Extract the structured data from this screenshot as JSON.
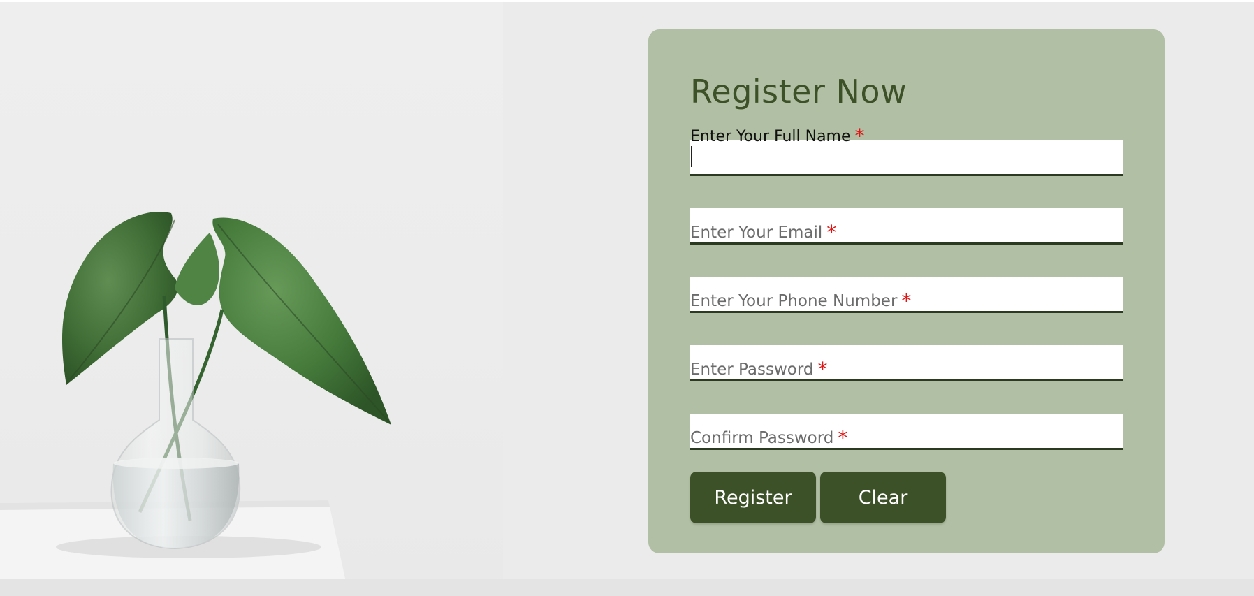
{
  "form": {
    "title": "Register Now",
    "required_mark": "*",
    "fields": [
      {
        "label": "Enter Your Full Name",
        "value": ""
      },
      {
        "label": "Enter Your Email",
        "value": ""
      },
      {
        "label": "Enter Your Phone Number",
        "value": ""
      },
      {
        "label": "Enter Password",
        "value": ""
      },
      {
        "label": "Confirm Password",
        "value": ""
      }
    ],
    "buttons": {
      "register": "Register",
      "clear": "Clear"
    }
  },
  "colors": {
    "page_background": "#ebebeb",
    "card_background": "#b1bfa4",
    "title": "#3d5128",
    "button": "#3c5128",
    "required": "#e01515"
  },
  "hero": {
    "icon": "plant-in-glass-vase-photo"
  }
}
